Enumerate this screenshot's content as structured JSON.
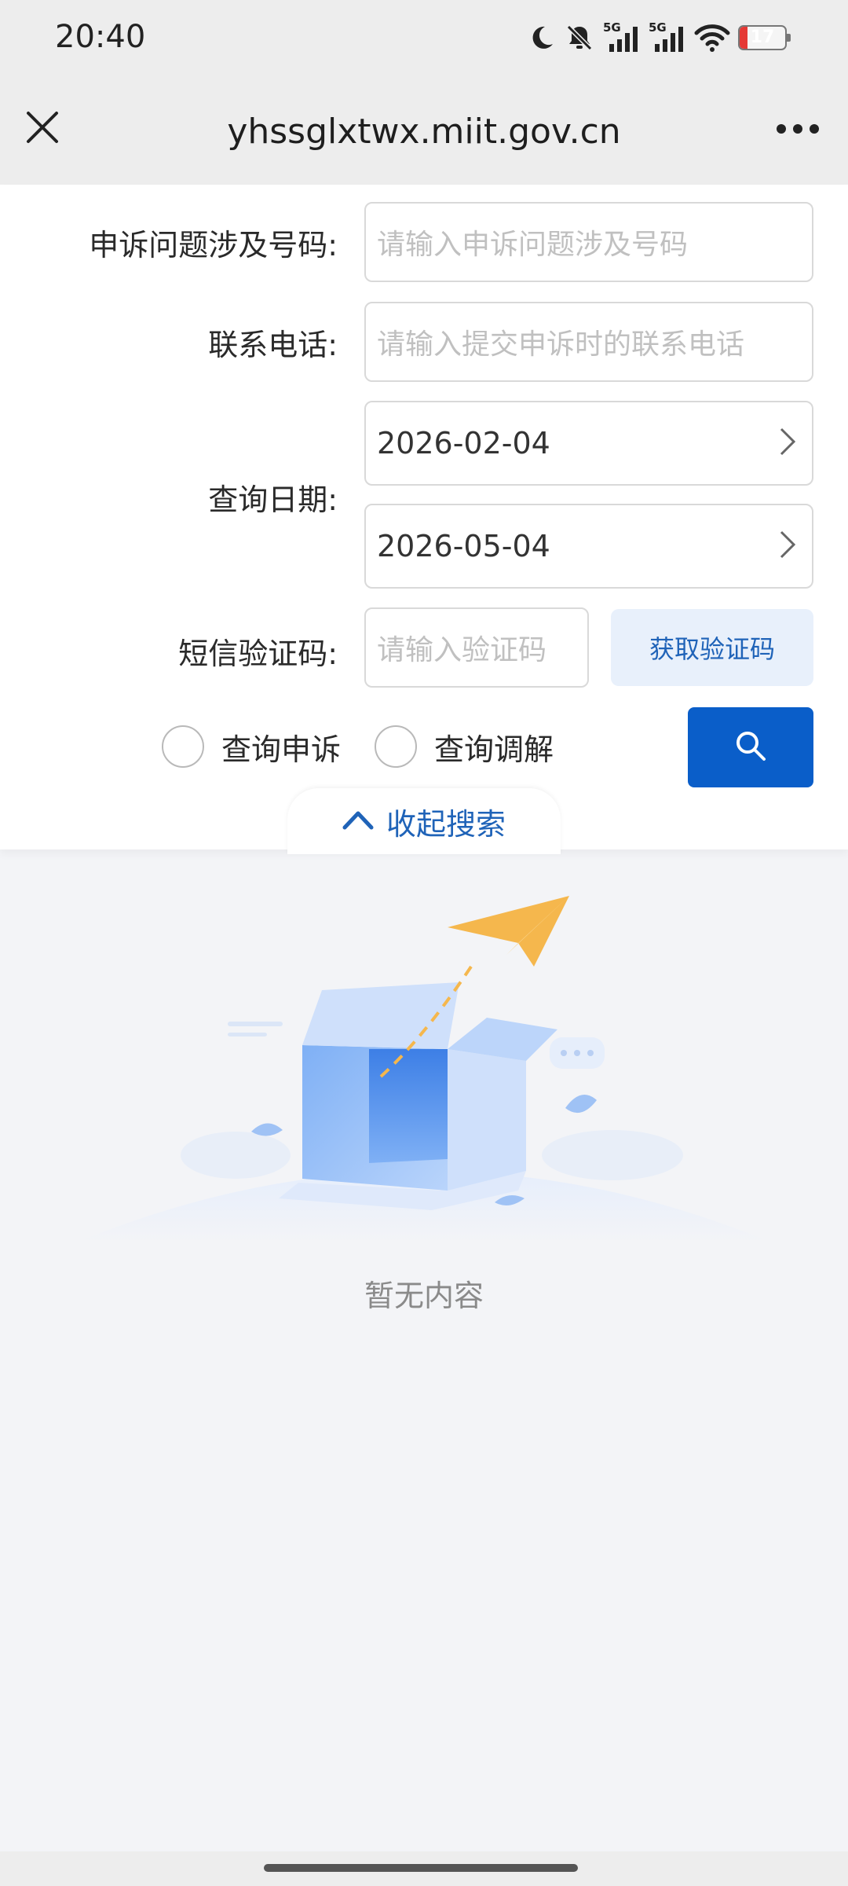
{
  "status_bar": {
    "time": "20:40",
    "network_1": "5G",
    "network_2": "5G",
    "battery_level": "17",
    "icons": [
      "moon-icon",
      "mute-bell-icon",
      "signal-icon",
      "signal-icon",
      "wifi-icon",
      "battery-icon"
    ]
  },
  "nav": {
    "title": "yhssglxtwx.miit.gov.cn",
    "close_icon": "close-icon",
    "more_icon": "more-icon"
  },
  "form": {
    "number_label": "申诉问题涉及号码:",
    "number_placeholder": "请输入申诉问题涉及号码",
    "phone_label": "联系电话:",
    "phone_placeholder": "请输入提交申诉时的联系电话",
    "date_label": "查询日期:",
    "date_start": "2026-02-04",
    "date_end": "2026-05-04",
    "sms_label": "短信验证码:",
    "sms_placeholder": "请输入验证码",
    "get_code_label": "获取验证码",
    "radio_complaint": "查询申诉",
    "radio_mediation": "查询调解",
    "collapse_label": "收起搜索"
  },
  "colors": {
    "primary": "#0a5ec9",
    "link": "#1f63b8",
    "code_button_bg": "#e8f0fb"
  },
  "empty_state": {
    "text": "暂无内容"
  }
}
